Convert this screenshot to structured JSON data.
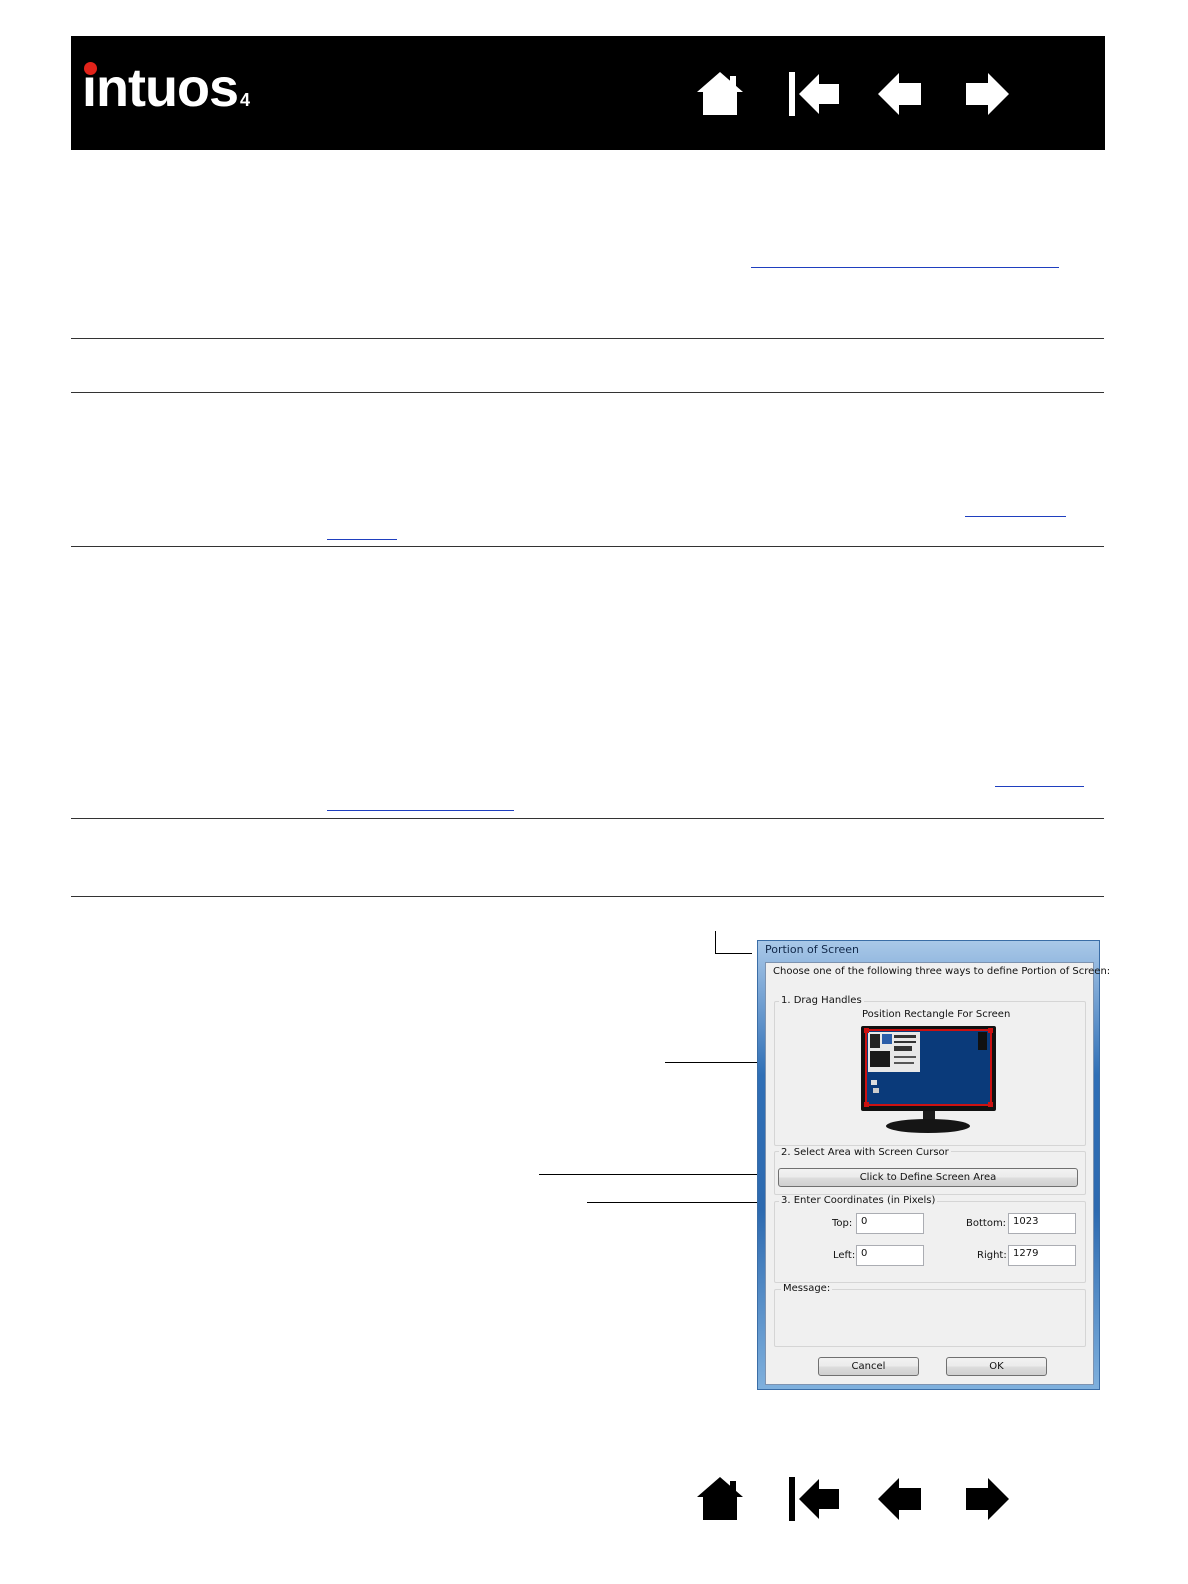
{
  "header": {
    "logo_text": "intuos",
    "logo_version": "4",
    "logo_dot_color": "#e2231a",
    "nav_icons": [
      "home-icon",
      "first-page-icon",
      "previous-page-icon",
      "next-page-icon"
    ]
  },
  "footer": {
    "nav_icons": [
      "home-icon",
      "first-page-icon",
      "previous-page-icon",
      "next-page-icon"
    ]
  },
  "dialog": {
    "title": "Portion of Screen",
    "instructions": "Choose one of the following three ways to define Portion of Screen:",
    "group1_label": "1. Drag Handles",
    "preview_label": "Position Rectangle For Screen",
    "group2_label": "2. Select Area with Screen Cursor",
    "define_button": "Click to Define Screen Area",
    "group3_label": "3. Enter Coordinates (in Pixels)",
    "top_label": "Top:",
    "top_value": "0",
    "bottom_label": "Bottom:",
    "bottom_value": "1023",
    "left_label": "Left:",
    "left_value": "0",
    "right_label": "Right:",
    "right_value": "1279",
    "message_label": "Message:",
    "cancel_button": "Cancel",
    "ok_button": "OK"
  },
  "colors": {
    "header_bg": "#000000",
    "link_underline": "#1f3fbf",
    "screen_blue": "#0a3a7a",
    "handle_red": "#cc1111"
  }
}
